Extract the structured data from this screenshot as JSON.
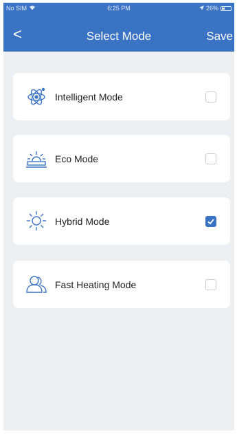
{
  "status_bar": {
    "carrier": "No SIM",
    "time": "6:25 PM",
    "battery": "26%"
  },
  "header": {
    "back_label": "<",
    "title": "Select Mode",
    "save_label": "Save"
  },
  "modes": [
    {
      "label": "Intelligent Mode",
      "icon": "atom-icon",
      "checked": false
    },
    {
      "label": "Eco Mode",
      "icon": "eco-sun-icon",
      "checked": false
    },
    {
      "label": "Hybrid Mode",
      "icon": "sun-icon",
      "checked": true
    },
    {
      "label": "Fast Heating Mode",
      "icon": "people-icon",
      "checked": false
    }
  ],
  "colors": {
    "accent": "#3a73c4",
    "background": "#eeeff2",
    "card": "#ffffff"
  }
}
